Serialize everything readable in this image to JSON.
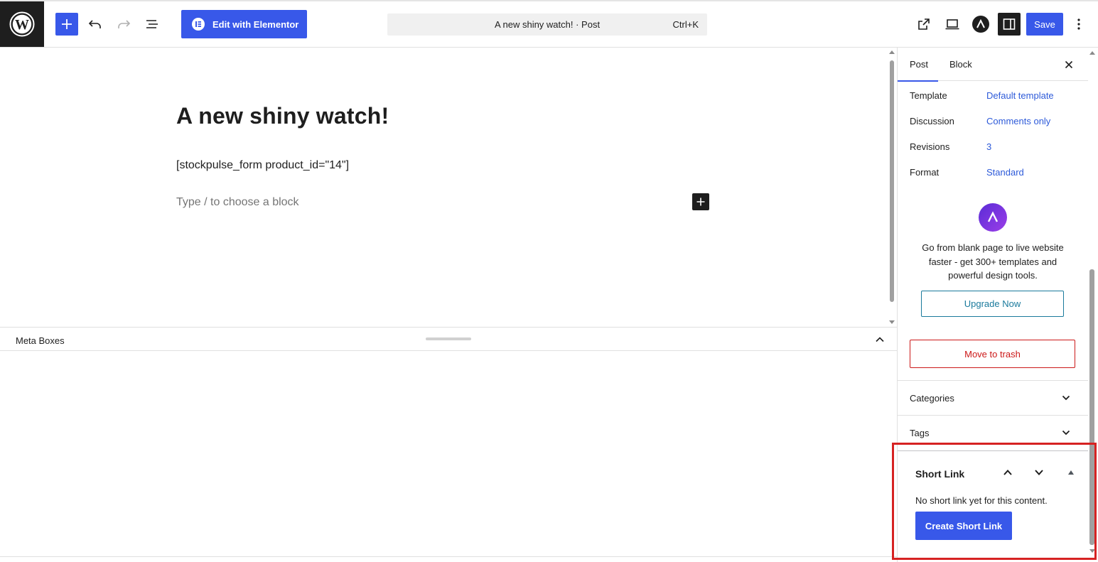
{
  "toolbar": {
    "logo_icon": "wordpress-logo-icon",
    "inserter_icon": "plus-icon",
    "undo_icon": "undo-icon",
    "redo_icon": "redo-icon",
    "list_view_icon": "list-view-icon",
    "elementor_label": "Edit with Elementor",
    "command_title": "A new shiny watch! · Post",
    "command_shortcut": "Ctrl+K",
    "view_post_icon": "external-link-icon",
    "preview_icon": "desktop-preview-icon",
    "astra_icon": "astra-logo-icon",
    "settings_icon": "sidebar-toggle-icon",
    "save_label": "Save",
    "options_icon": "more-vertical-icon",
    "accent_color": "#3858e9"
  },
  "editor": {
    "title": "A new shiny watch!",
    "shortcode": "[stockpulse_form product_id=\"14\"]",
    "placeholder": "Type / to choose a block"
  },
  "meta_boxes": {
    "title": "Meta Boxes"
  },
  "sidebar": {
    "tabs": [
      {
        "label": "Post",
        "active": true
      },
      {
        "label": "Block",
        "active": false
      }
    ],
    "close_icon": "close-icon",
    "rows": [
      {
        "label": "Template",
        "value": "Default template"
      },
      {
        "label": "Discussion",
        "value": "Comments only"
      },
      {
        "label": "Revisions",
        "value": "3"
      },
      {
        "label": "Format",
        "value": "Standard"
      }
    ],
    "promo": {
      "text": "Go from blank page to live website faster - get 300+ templates and powerful design tools.",
      "button": "Upgrade Now"
    },
    "trash_label": "Move to trash",
    "panels": [
      {
        "label": "Categories"
      },
      {
        "label": "Tags"
      }
    ],
    "short_link": {
      "title": "Short Link",
      "description": "No short link yet for this content.",
      "button": "Create Short Link"
    }
  }
}
